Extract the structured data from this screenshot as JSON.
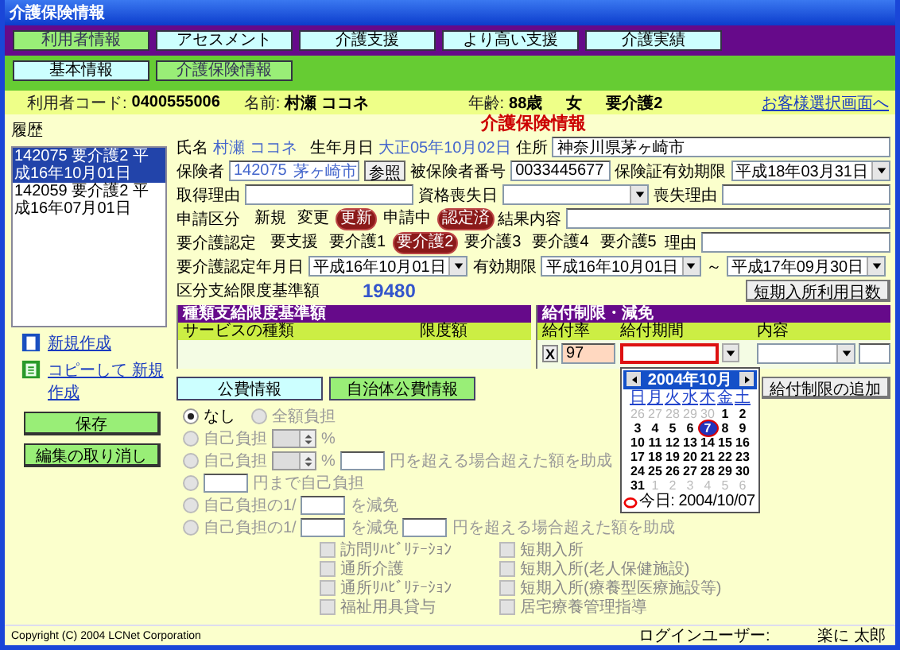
{
  "window": {
    "title": "介護保険情報"
  },
  "main_nav": [
    {
      "label": "利用者情報",
      "selected": true
    },
    {
      "label": "アセスメント",
      "selected": false
    },
    {
      "label": "介護支援",
      "selected": false
    },
    {
      "label": "より高い支援",
      "selected": false
    },
    {
      "label": "介護実績",
      "selected": false
    }
  ],
  "sub_nav": [
    {
      "label": "基本情報",
      "selected": false
    },
    {
      "label": "介護保険情報",
      "selected": true
    }
  ],
  "client_bar": {
    "code_label": "利用者コード:",
    "code": "0400555006",
    "name_label": "名前:",
    "name": "村瀬 ココネ",
    "age_label": "年齢:",
    "age": "88歳",
    "sex": "女",
    "care_level": "要介護2",
    "link": "お客様選択画面へ"
  },
  "history": {
    "label": "履歴",
    "items": [
      {
        "text": "142075 要介護2 平成16年10月01日",
        "selected": true
      },
      {
        "text": "142059 要介護2 平成16年07月01日",
        "selected": false
      }
    ]
  },
  "actions": {
    "new_link": "新規作成",
    "copy_link": "コピーして 新規作成",
    "save_button": "保存",
    "cancel_button": "編集の取り消し"
  },
  "form": {
    "title": "介護保険情報",
    "name_label": "氏名",
    "name": "村瀬 ココネ",
    "birth_label": "生年月日",
    "birth": "大正05年10月02日",
    "address_label": "住所",
    "address": "神奈川県茅ヶ崎市",
    "insurer_label": "保険者",
    "insurer_code": "142075",
    "insurer_name": "茅ヶ崎市",
    "ref_button": "参照",
    "insured_no_label": "被保険者番号",
    "insured_no": "0033445677",
    "card_expiry_label": "保険証有効期限",
    "card_expiry": "平成18年03月31日",
    "acquire_reason_label": "取得理由",
    "loss_date_label": "資格喪失日",
    "loss_reason_label": "喪失理由",
    "application_label": "申請区分",
    "application_options": [
      {
        "label": "新規",
        "selected": false
      },
      {
        "label": "変更",
        "selected": false
      },
      {
        "label": "更新",
        "selected": true
      }
    ],
    "status_options": [
      {
        "label": "申請中",
        "selected": false
      },
      {
        "label": "認定済",
        "selected": true
      }
    ],
    "result_label": "結果内容",
    "care_label": "要介護認定",
    "care_options": [
      {
        "label": "要支援",
        "selected": false
      },
      {
        "label": "要介護1",
        "selected": false
      },
      {
        "label": "要介護2",
        "selected": true
      },
      {
        "label": "要介護3",
        "selected": false
      },
      {
        "label": "要介護4",
        "selected": false
      },
      {
        "label": "要介護5",
        "selected": false
      }
    ],
    "care_reason_label": "理由",
    "cert_date_label": "要介護認定年月日",
    "cert_date": "平成16年10月01日",
    "valid_label": "有効期限",
    "valid_from": "平成16年10月01日",
    "tilde": "～",
    "valid_to": "平成17年09月30日",
    "limit_label": "区分支給限度基準額",
    "limit": "19480",
    "short_stay_button": "短期入所利用日数"
  },
  "service_limit": {
    "title": "種類支給限度基準額",
    "columns": [
      "サービスの種類",
      "限度額"
    ]
  },
  "benefit_limit": {
    "title": "給付制限・減免",
    "columns": [
      "給付率",
      "給付期間",
      "内容"
    ],
    "delete": "X",
    "rate": "97"
  },
  "calendar": {
    "month": "2004年10月",
    "weekdays": [
      "日",
      "月",
      "火",
      "水",
      "木",
      "金",
      "土"
    ],
    "today": "今日: 2004/10/07",
    "days": [
      {
        "text": "26",
        "in_month": false,
        "selected": false
      },
      {
        "text": "27",
        "in_month": false,
        "selected": false
      },
      {
        "text": "28",
        "in_month": false,
        "selected": false
      },
      {
        "text": "29",
        "in_month": false,
        "selected": false
      },
      {
        "text": "30",
        "in_month": false,
        "selected": false
      },
      {
        "text": "1",
        "in_month": true,
        "selected": false
      },
      {
        "text": "2",
        "in_month": true,
        "selected": false
      },
      {
        "text": "3",
        "in_month": true,
        "selected": false
      },
      {
        "text": "4",
        "in_month": true,
        "selected": false
      },
      {
        "text": "5",
        "in_month": true,
        "selected": false
      },
      {
        "text": "6",
        "in_month": true,
        "selected": false
      },
      {
        "text": "7",
        "in_month": true,
        "selected": true
      },
      {
        "text": "8",
        "in_month": true,
        "selected": false
      },
      {
        "text": "9",
        "in_month": true,
        "selected": false
      },
      {
        "text": "10",
        "in_month": true,
        "selected": false
      },
      {
        "text": "11",
        "in_month": true,
        "selected": false
      },
      {
        "text": "12",
        "in_month": true,
        "selected": false
      },
      {
        "text": "13",
        "in_month": true,
        "selected": false
      },
      {
        "text": "14",
        "in_month": true,
        "selected": false
      },
      {
        "text": "15",
        "in_month": true,
        "selected": false
      },
      {
        "text": "16",
        "in_month": true,
        "selected": false
      },
      {
        "text": "17",
        "in_month": true,
        "selected": false
      },
      {
        "text": "18",
        "in_month": true,
        "selected": false
      },
      {
        "text": "19",
        "in_month": true,
        "selected": false
      },
      {
        "text": "20",
        "in_month": true,
        "selected": false
      },
      {
        "text": "21",
        "in_month": true,
        "selected": false
      },
      {
        "text": "22",
        "in_month": true,
        "selected": false
      },
      {
        "text": "23",
        "in_month": true,
        "selected": false
      },
      {
        "text": "24",
        "in_month": true,
        "selected": false
      },
      {
        "text": "25",
        "in_month": true,
        "selected": false
      },
      {
        "text": "26",
        "in_month": true,
        "selected": false
      },
      {
        "text": "27",
        "in_month": true,
        "selected": false
      },
      {
        "text": "28",
        "in_month": true,
        "selected": false
      },
      {
        "text": "29",
        "in_month": true,
        "selected": false
      },
      {
        "text": "30",
        "in_month": true,
        "selected": false
      },
      {
        "text": "31",
        "in_month": true,
        "selected": false
      },
      {
        "text": "1",
        "in_month": false,
        "selected": false
      },
      {
        "text": "2",
        "in_month": false,
        "selected": false
      },
      {
        "text": "3",
        "in_month": false,
        "selected": false
      },
      {
        "text": "4",
        "in_month": false,
        "selected": false
      },
      {
        "text": "5",
        "in_month": false,
        "selected": false
      },
      {
        "text": "6",
        "in_month": false,
        "selected": false
      }
    ]
  },
  "public_tabs": [
    {
      "label": "公費情報",
      "selected": false
    },
    {
      "label": "自治体公費情報",
      "selected": true
    }
  ],
  "add_button": "給付制限の追加",
  "payment_rows": [
    {
      "options": [
        {
          "selected": true,
          "disabled": false,
          "parts": [
            {
              "kind": "text",
              "text": "なし"
            }
          ]
        },
        {
          "selected": false,
          "disabled": true,
          "parts": [
            {
              "kind": "text",
              "text": "全額負担"
            }
          ]
        }
      ]
    },
    {
      "options": [
        {
          "selected": false,
          "disabled": true,
          "parts": [
            {
              "kind": "text",
              "text": "自己負担"
            },
            {
              "kind": "spin"
            },
            {
              "kind": "text",
              "text": "%"
            }
          ]
        }
      ]
    },
    {
      "options": [
        {
          "selected": false,
          "disabled": true,
          "parts": [
            {
              "kind": "text",
              "text": "自己負担"
            },
            {
              "kind": "spin"
            },
            {
              "kind": "text",
              "text": "%"
            },
            {
              "kind": "input"
            },
            {
              "kind": "text",
              "text": "円を超える場合超えた額を助成"
            }
          ]
        }
      ]
    },
    {
      "options": [
        {
          "selected": false,
          "disabled": true,
          "parts": [
            {
              "kind": "input"
            },
            {
              "kind": "text",
              "text": "円まで自己負担"
            }
          ]
        }
      ]
    },
    {
      "options": [
        {
          "selected": false,
          "disabled": true,
          "parts": [
            {
              "kind": "text",
              "text": "自己負担の1/"
            },
            {
              "kind": "input"
            },
            {
              "kind": "text",
              "text": "を減免"
            }
          ]
        }
      ]
    },
    {
      "options": [
        {
          "selected": false,
          "disabled": true,
          "parts": [
            {
              "kind": "text",
              "text": "自己負担の1/"
            },
            {
              "kind": "input"
            },
            {
              "kind": "text",
              "text": "を減免"
            },
            {
              "kind": "input"
            },
            {
              "kind": "text",
              "text": "円を超える場合超えた額を助成"
            }
          ]
        }
      ]
    }
  ],
  "checkbox_columns": [
    [
      {
        "label": "訪問ﾘﾊﾋﾞﾘﾃｰｼｮﾝ",
        "checked": false,
        "disabled": true
      },
      {
        "label": "通所介護",
        "checked": false,
        "disabled": true
      },
      {
        "label": "通所ﾘﾊﾋﾞﾘﾃｰｼｮﾝ",
        "checked": false,
        "disabled": true
      },
      {
        "label": "福祉用具貸与",
        "checked": false,
        "disabled": true
      }
    ],
    [
      {
        "label": "短期入所",
        "checked": false,
        "disabled": true
      },
      {
        "label": "短期入所(老人保健施設)",
        "checked": false,
        "disabled": true
      },
      {
        "label": "短期入所(療養型医療施設等)",
        "checked": false,
        "disabled": true
      },
      {
        "label": "居宅療養管理指導",
        "checked": false,
        "disabled": true
      }
    ]
  ],
  "footer": {
    "copyright": "Copyright (C) 2004 LCNet Corporation",
    "login_label": "ログインユーザー:",
    "user": "楽に 太郎"
  }
}
